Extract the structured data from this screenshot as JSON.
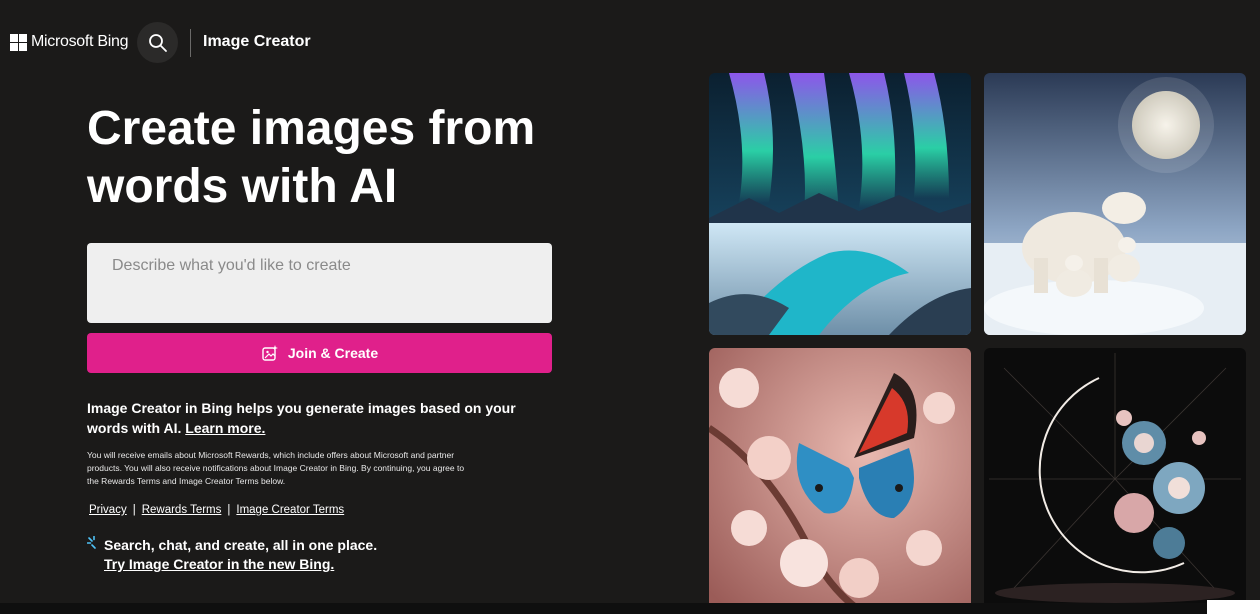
{
  "header": {
    "brand_label": "Microsoft Bing",
    "product_title": "Image Creator",
    "search_icon": "search-icon"
  },
  "hero": {
    "title_line1": "Create images from",
    "title_line2": "words with AI"
  },
  "prompt": {
    "placeholder": "Describe what you'd like to create",
    "value": ""
  },
  "join_button": {
    "label": "Join & Create",
    "icon": "image-sparkle-icon",
    "color": "#e0208b"
  },
  "info": {
    "text": "Image Creator in Bing helps you generate images based on your words with AI.",
    "learn_more": "Learn more."
  },
  "disclaimer": "You will receive emails about Microsoft Rewards, which include offers about Microsoft and partner products. You will also receive notifications about Image Creator in Bing. By continuing, you agree to the Rewards Terms and Image Creator Terms below.",
  "links": {
    "privacy": "Privacy",
    "rewards_terms": "Rewards Terms",
    "image_creator_terms": "Image Creator Terms",
    "separator": "|"
  },
  "promo": {
    "icon": "sparkle-icon",
    "line1": "Search, chat, and create, all in one place.",
    "line2": "Try Image Creator in the new Bing."
  },
  "gallery": [
    {
      "name": "gallery-image-aurora"
    },
    {
      "name": "gallery-image-polar-bears"
    },
    {
      "name": "gallery-image-butterfly"
    },
    {
      "name": "gallery-image-crescent-moon"
    }
  ],
  "colors": {
    "background": "#1b1a19",
    "accent": "#e0208b"
  }
}
